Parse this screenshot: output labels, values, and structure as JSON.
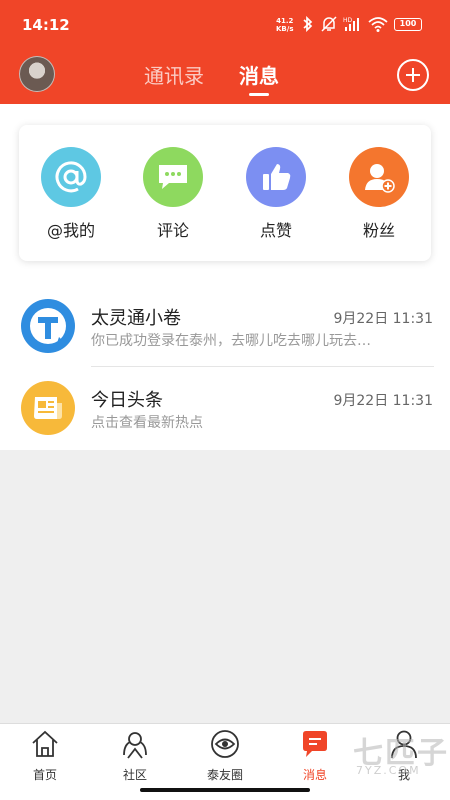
{
  "status_bar": {
    "time": "14:12",
    "net_speed_value": "41.2",
    "net_speed_unit": "KB/s",
    "battery": "100"
  },
  "header": {
    "tabs": [
      {
        "label": "通讯录",
        "active": false
      },
      {
        "label": "消息",
        "active": true
      }
    ],
    "accent_color": "#f04528"
  },
  "quick_actions": [
    {
      "label": "@我的",
      "icon": "at-icon",
      "color": "#5ec8e3"
    },
    {
      "label": "评论",
      "icon": "comment-icon",
      "color": "#8ed95f"
    },
    {
      "label": "点赞",
      "icon": "thumbs-up-icon",
      "color": "#7c8ff2"
    },
    {
      "label": "粉丝",
      "icon": "add-user-icon",
      "color": "#f4762e"
    }
  ],
  "messages": [
    {
      "title": "太灵通小卷",
      "time": "9月22日 11:31",
      "preview": "你已成功登录在泰州，去哪儿吃去哪儿玩去看看吧",
      "icon": "t-logo-icon",
      "color": "#2f8de0"
    },
    {
      "title": "今日头条",
      "time": "9月22日 11:31",
      "preview": "点击查看最新热点",
      "icon": "newspaper-icon",
      "color": "#f7b93a"
    }
  ],
  "bottom_nav": [
    {
      "label": "首页",
      "icon": "home-icon"
    },
    {
      "label": "社区",
      "icon": "community-icon"
    },
    {
      "label": "泰友圈",
      "icon": "circle-eye-icon"
    },
    {
      "label": "消息",
      "icon": "message-icon",
      "active": true
    },
    {
      "label": "我",
      "icon": "person-icon"
    }
  ],
  "watermark": {
    "text": "七匹子",
    "sub": "7YZ.COM"
  }
}
